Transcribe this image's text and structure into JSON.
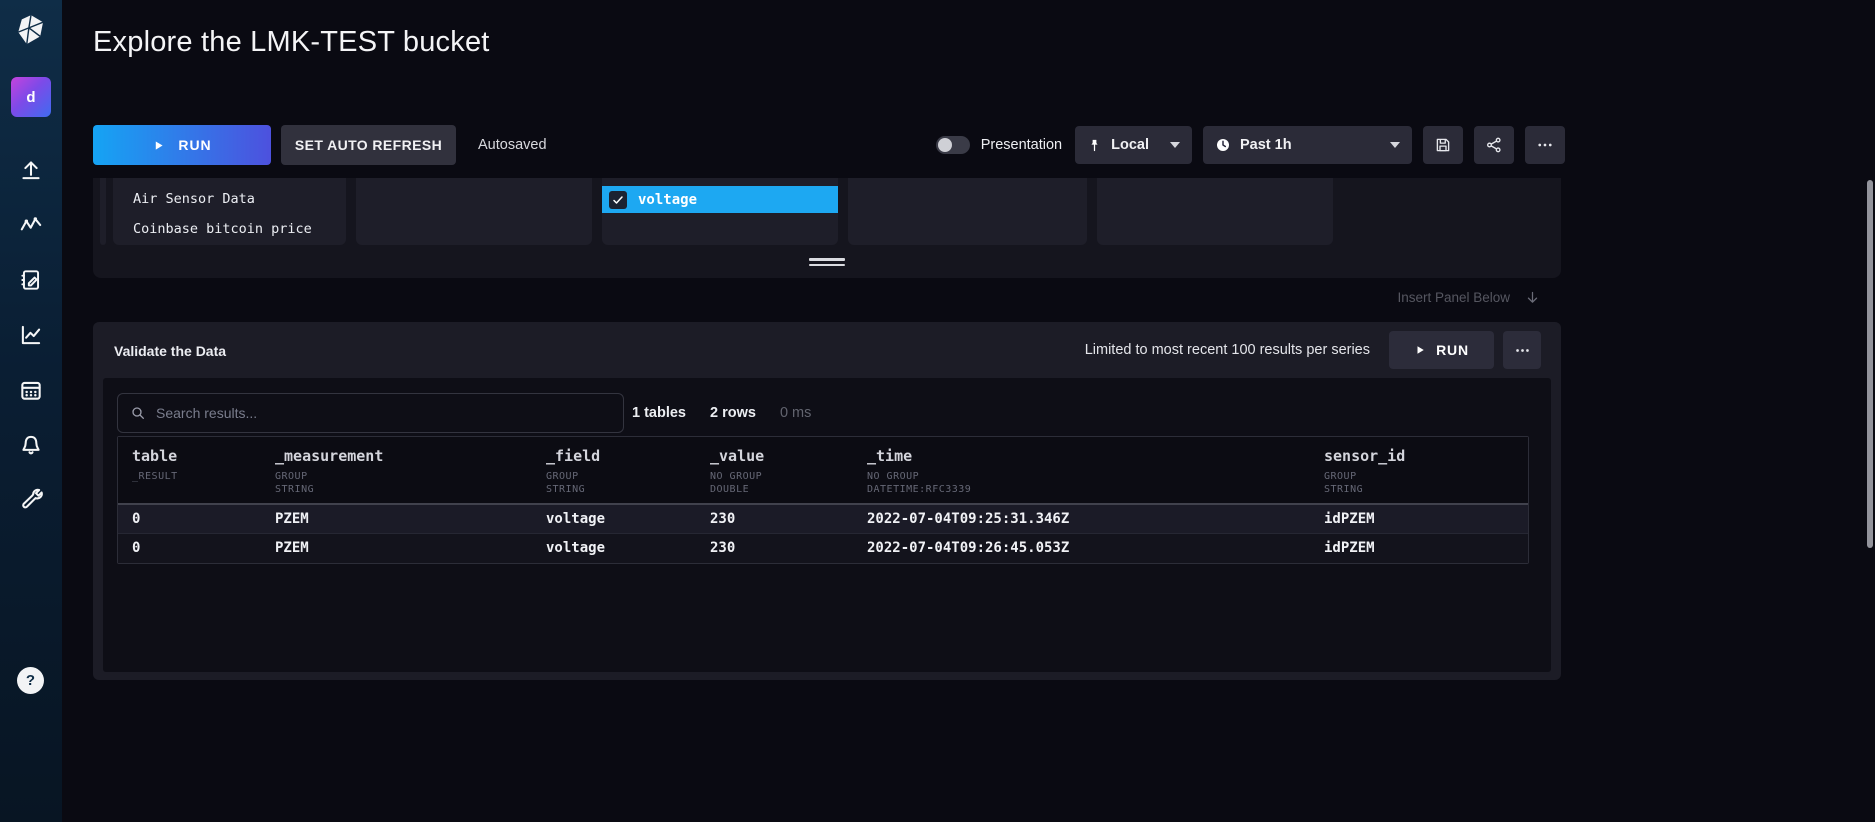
{
  "page": {
    "title": "Explore the LMK-TEST bucket"
  },
  "sidebar": {
    "avatar_label": "d",
    "help_label": "?"
  },
  "toolbar": {
    "run_label": "RUN",
    "set_auto_refresh_label": "SET AUTO REFRESH",
    "autosaved_label": "Autosaved",
    "presentation_label": "Presentation",
    "source_label": "Local",
    "time_range_label": "Past 1h"
  },
  "builder": {
    "bucket_items": [
      "Air Sensor Data",
      "Coinbase bitcoin price"
    ],
    "selected_field": {
      "label": "voltage",
      "checked": true
    },
    "insert_panel_label": "Insert Panel Below"
  },
  "validate": {
    "title": "Validate the Data",
    "limit_note": "Limited to most recent 100 results per series",
    "run_label": "RUN",
    "search_placeholder": "Search results...",
    "stats": {
      "tables": "1 tables",
      "rows": "2 rows",
      "time": "0 ms"
    },
    "table": {
      "columns": [
        {
          "name": "table",
          "sub": [
            "_RESULT"
          ]
        },
        {
          "name": "_measurement",
          "sub": [
            "GROUP",
            "STRING"
          ]
        },
        {
          "name": "_field",
          "sub": [
            "GROUP",
            "STRING"
          ]
        },
        {
          "name": "_value",
          "sub": [
            "NO GROUP",
            "DOUBLE"
          ]
        },
        {
          "name": "_time",
          "sub": [
            "NO GROUP",
            "DATETIME:RFC3339"
          ]
        },
        {
          "name": "sensor_id",
          "sub": [
            "GROUP",
            "STRING"
          ]
        }
      ],
      "rows": [
        [
          "0",
          "PZEM",
          "voltage",
          "230",
          "2022-07-04T09:25:31.346Z",
          "idPZEM"
        ],
        [
          "0",
          "PZEM",
          "voltage",
          "230",
          "2022-07-04T09:26:45.053Z",
          "idPZEM"
        ]
      ]
    }
  },
  "colors": {
    "accent_blue": "#1DA8F2",
    "run_gradient_start": "#15A4F4",
    "run_gradient_end": "#4D51DE",
    "sidebar_top": "#0F2D47",
    "panel_bg": "#1C1C26"
  }
}
